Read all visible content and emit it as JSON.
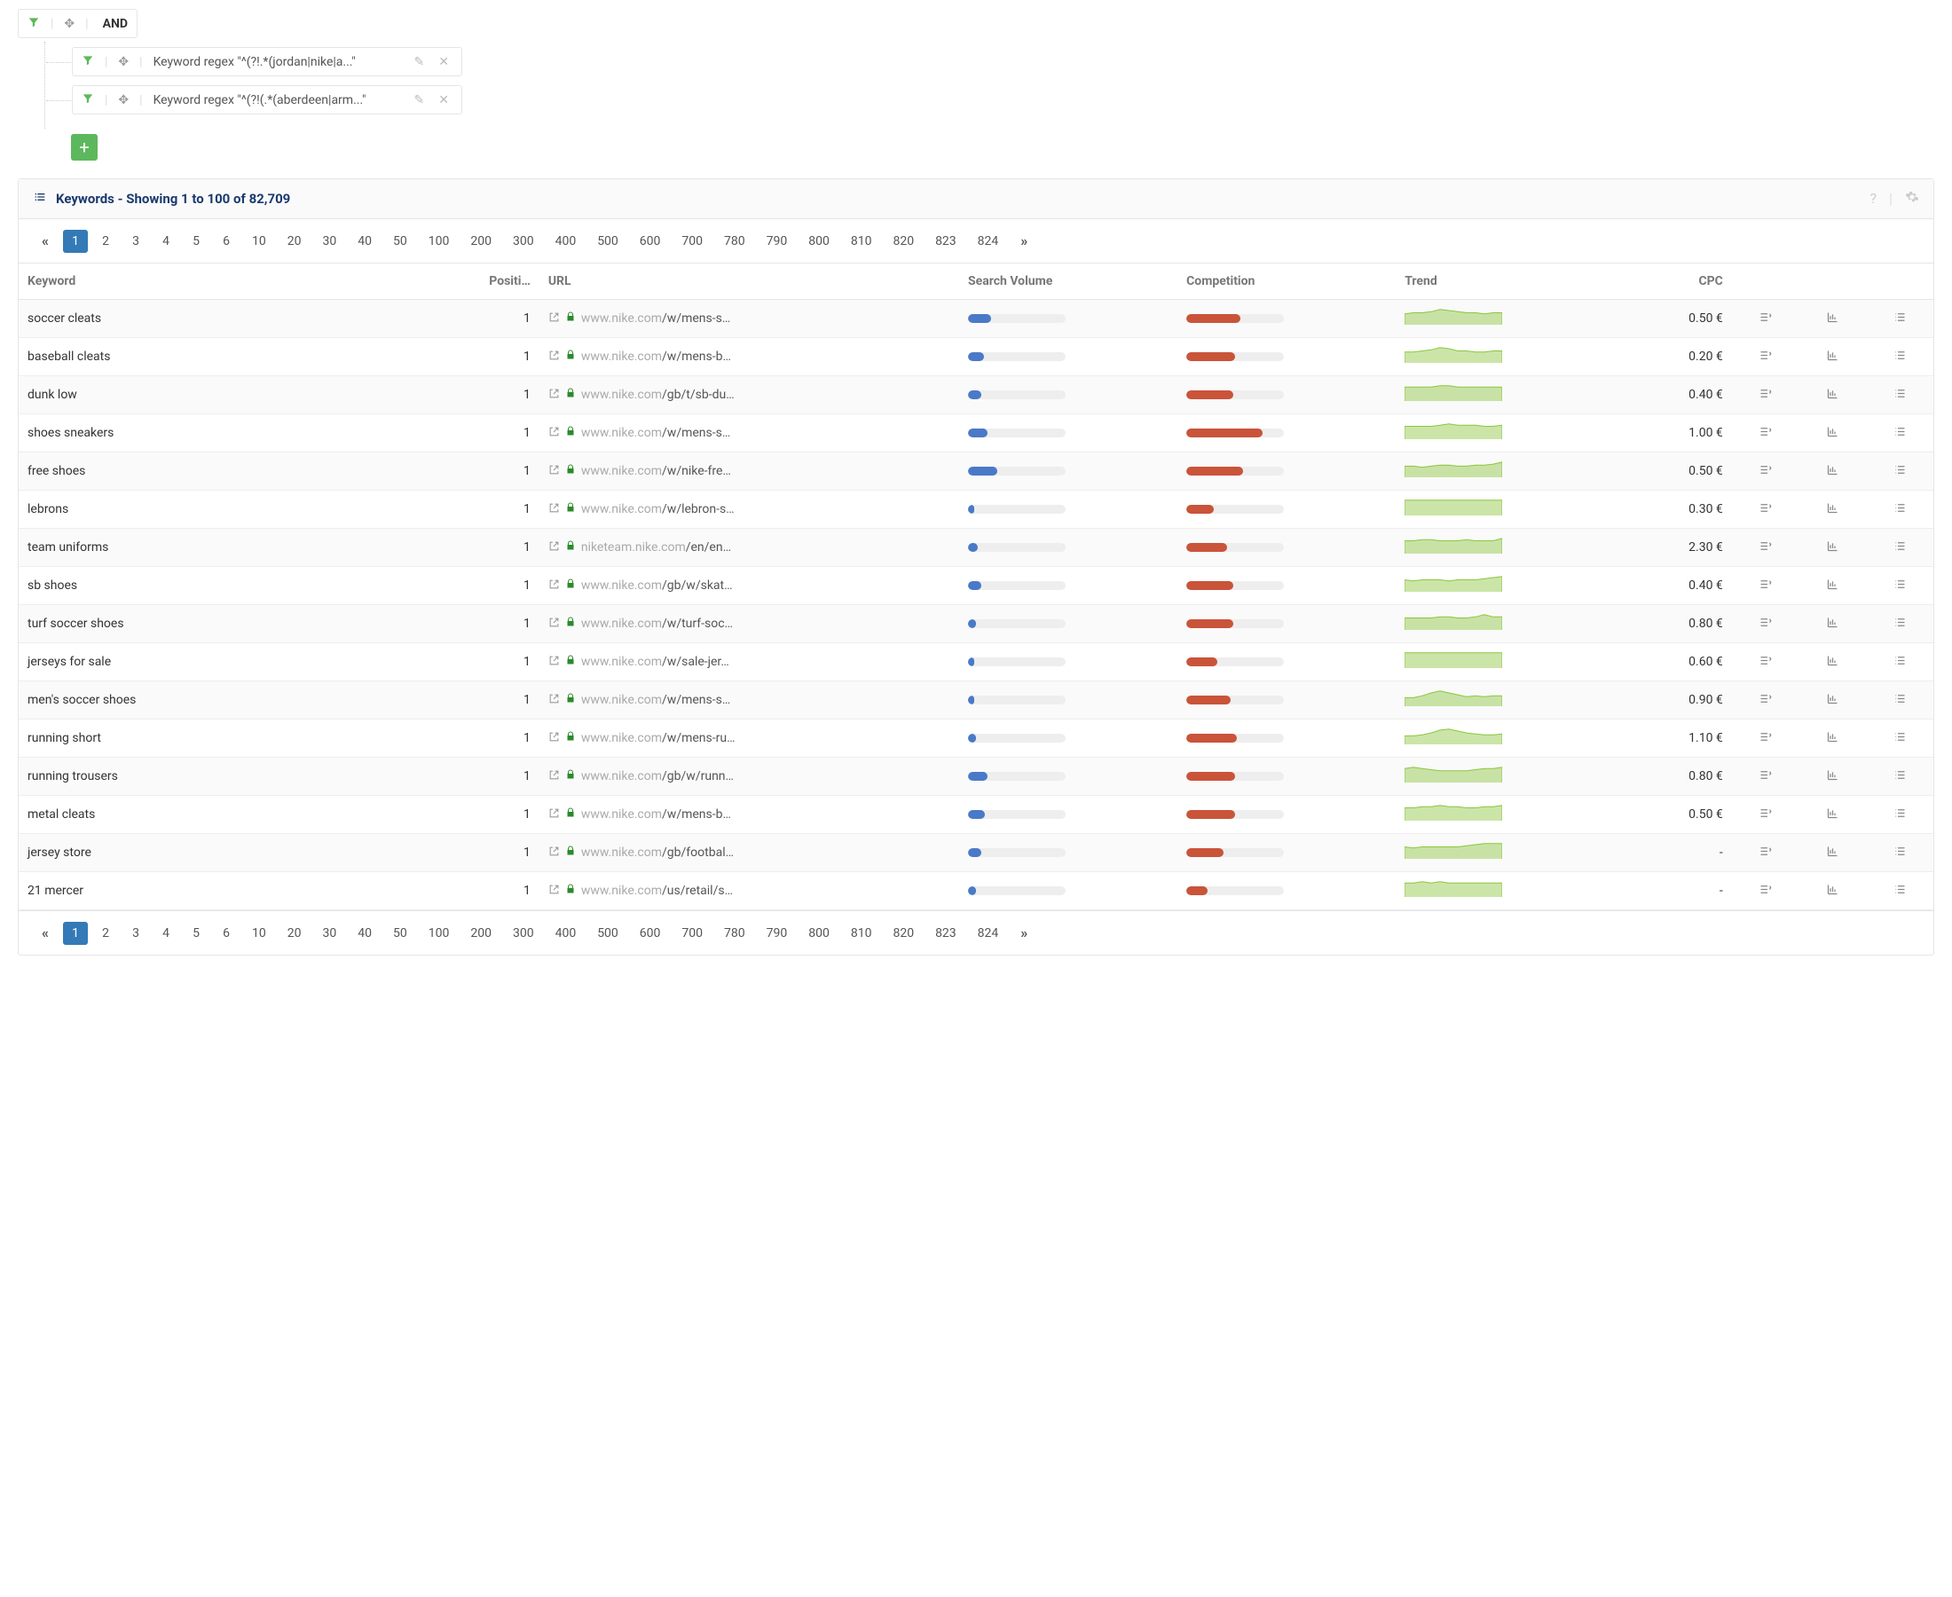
{
  "filter": {
    "root_label": "AND",
    "children": [
      {
        "text": "Keyword regex \"^(?!.*(jordan|nike|a...\""
      },
      {
        "text": "Keyword regex \"^(?!(.*(aberdeen|arm...\""
      }
    ]
  },
  "panel": {
    "title": "Keywords - Showing 1 to 100 of 82,709"
  },
  "pagination": [
    "1",
    "2",
    "3",
    "4",
    "5",
    "6",
    "10",
    "20",
    "30",
    "40",
    "50",
    "100",
    "200",
    "300",
    "400",
    "500",
    "600",
    "700",
    "780",
    "790",
    "800",
    "810",
    "820",
    "823",
    "824"
  ],
  "columns": {
    "keyword": "Keyword",
    "position": "Positi…",
    "url": "URL",
    "volume": "Search Volume",
    "competition": "Competition",
    "trend": "Trend",
    "cpc": "CPC"
  },
  "currency": "€",
  "rows": [
    {
      "keyword": "soccer cleats",
      "position": 1,
      "domain": "www.nike.com",
      "path": "/w/mens-s…",
      "volume": 24,
      "competition": 55,
      "trend": [
        9,
        10,
        10,
        11,
        13,
        12,
        11,
        10,
        10,
        9,
        10,
        10
      ],
      "cpc": "0.50 €"
    },
    {
      "keyword": "baseball cleats",
      "position": 1,
      "domain": "www.nike.com",
      "path": "/w/mens-b…",
      "volume": 16,
      "competition": 50,
      "trend": [
        9,
        9,
        10,
        11,
        13,
        12,
        10,
        10,
        9,
        9,
        10,
        10
      ],
      "cpc": "0.20 €"
    },
    {
      "keyword": "dunk low",
      "position": 1,
      "domain": "www.nike.com",
      "path": "/gb/t/sb-du…",
      "volume": 14,
      "competition": 48,
      "trend": [
        10,
        10,
        10,
        10,
        11,
        11,
        10,
        10,
        10,
        10,
        10,
        10
      ],
      "cpc": "0.40 €"
    },
    {
      "keyword": "shoes sneakers",
      "position": 1,
      "domain": "www.nike.com",
      "path": "/w/mens-s…",
      "volume": 20,
      "competition": 78,
      "trend": [
        10,
        10,
        10,
        10,
        11,
        12,
        11,
        11,
        11,
        10,
        10,
        11
      ],
      "cpc": "1.00 €"
    },
    {
      "keyword": "free shoes",
      "position": 1,
      "domain": "www.nike.com",
      "path": "/w/nike-fre…",
      "volume": 30,
      "competition": 58,
      "trend": [
        10,
        10,
        9,
        10,
        11,
        11,
        10,
        10,
        11,
        11,
        12,
        14
      ],
      "cpc": "0.50 €"
    },
    {
      "keyword": "lebrons",
      "position": 1,
      "domain": "www.nike.com",
      "path": "/w/lebron-s…",
      "volume": 6,
      "competition": 28,
      "trend": [
        10,
        10,
        10,
        10,
        10,
        10,
        10,
        10,
        10,
        10,
        10,
        10
      ],
      "cpc": "0.30 €"
    },
    {
      "keyword": "team uniforms",
      "position": 1,
      "domain": "niketeam.nike.com",
      "path": "/en/en…",
      "volume": 10,
      "competition": 42,
      "trend": [
        10,
        10,
        11,
        11,
        10,
        10,
        10,
        11,
        10,
        10,
        10,
        12
      ],
      "cpc": "2.30 €"
    },
    {
      "keyword": "sb shoes",
      "position": 1,
      "domain": "www.nike.com",
      "path": "/gb/w/skat…",
      "volume": 14,
      "competition": 48,
      "trend": [
        10,
        9,
        10,
        10,
        10,
        9,
        10,
        10,
        10,
        11,
        12,
        13
      ],
      "cpc": "0.40 €"
    },
    {
      "keyword": "turf soccer shoes",
      "position": 1,
      "domain": "www.nike.com",
      "path": "/w/turf-soc…",
      "volume": 8,
      "competition": 48,
      "trend": [
        10,
        10,
        10,
        10,
        11,
        11,
        10,
        10,
        11,
        13,
        11,
        11
      ],
      "cpc": "0.80 €"
    },
    {
      "keyword": "jerseys for sale",
      "position": 1,
      "domain": "www.nike.com",
      "path": "/w/sale-jer…",
      "volume": 6,
      "competition": 32,
      "trend": [
        10,
        10,
        10,
        10,
        10,
        10,
        10,
        10,
        10,
        10,
        10,
        10
      ],
      "cpc": "0.60 €"
    },
    {
      "keyword": "men's soccer shoes",
      "position": 1,
      "domain": "www.nike.com",
      "path": "/w/mens-s…",
      "volume": 6,
      "competition": 45,
      "trend": [
        8,
        8,
        10,
        13,
        15,
        13,
        11,
        9,
        10,
        9,
        10,
        10
      ],
      "cpc": "0.90 €"
    },
    {
      "keyword": "running short",
      "position": 1,
      "domain": "www.nike.com",
      "path": "/w/mens-ru…",
      "volume": 8,
      "competition": 52,
      "trend": [
        8,
        8,
        9,
        11,
        14,
        15,
        13,
        11,
        10,
        9,
        9,
        10
      ],
      "cpc": "1.10 €"
    },
    {
      "keyword": "running trousers",
      "position": 1,
      "domain": "www.nike.com",
      "path": "/gb/w/runn…",
      "volume": 20,
      "competition": 50,
      "trend": [
        11,
        12,
        11,
        10,
        9,
        9,
        9,
        9,
        10,
        11,
        11,
        12
      ],
      "cpc": "0.80 €"
    },
    {
      "keyword": "metal cleats",
      "position": 1,
      "domain": "www.nike.com",
      "path": "/w/mens-b…",
      "volume": 17,
      "competition": 50,
      "trend": [
        10,
        10,
        11,
        11,
        12,
        11,
        11,
        10,
        10,
        11,
        11,
        12
      ],
      "cpc": "0.50 €"
    },
    {
      "keyword": "jersey store",
      "position": 1,
      "domain": "www.nike.com",
      "path": "/gb/footbal…",
      "volume": 14,
      "competition": 38,
      "trend": [
        10,
        9,
        10,
        10,
        10,
        10,
        10,
        11,
        12,
        13,
        13,
        13
      ],
      "cpc": "-"
    },
    {
      "keyword": "21 mercer",
      "position": 1,
      "domain": "www.nike.com",
      "path": "/us/retail/s…",
      "volume": 8,
      "competition": 22,
      "trend": [
        10,
        10,
        11,
        10,
        11,
        10,
        10,
        10,
        10,
        10,
        10,
        10
      ],
      "cpc": "-"
    }
  ]
}
